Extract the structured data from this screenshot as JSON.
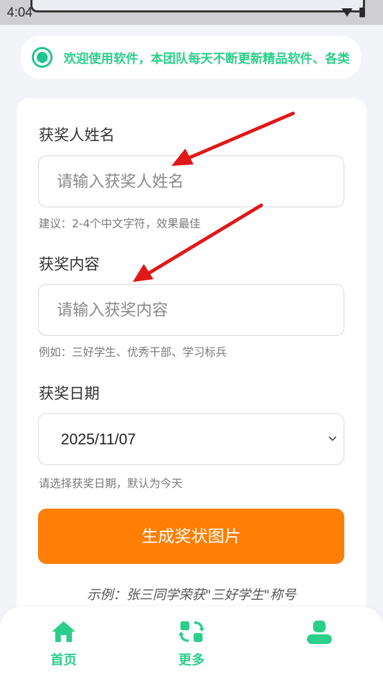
{
  "status_bar": {
    "time": "4:04"
  },
  "notice": {
    "text": "欢迎使用软件，本团队每天不断更新精品软件、各类"
  },
  "form": {
    "name": {
      "label": "获奖人姓名",
      "placeholder": "请输入获奖人姓名",
      "hint": "建议：2-4个中文字符，效果最佳"
    },
    "content": {
      "label": "获奖内容",
      "placeholder": "请输入获奖内容",
      "hint": "例如：三好学生、优秀干部、学习标兵"
    },
    "date": {
      "label": "获奖日期",
      "value": "2025/11/07",
      "hint": "请选择获奖日期，默认为今天"
    },
    "submit_label": "生成奖状图片",
    "example": "示例：张三同学荣获\"三好学生\"称号"
  },
  "bottom_nav": [
    {
      "label": "首页",
      "icon": "home-icon"
    },
    {
      "label": "更多",
      "icon": "refresh-icon"
    },
    {
      "label": "",
      "icon": "user-icon"
    }
  ],
  "colors": {
    "accent": "#2ccf8a",
    "button": "#ff7e05",
    "arrow": "#e01818"
  }
}
